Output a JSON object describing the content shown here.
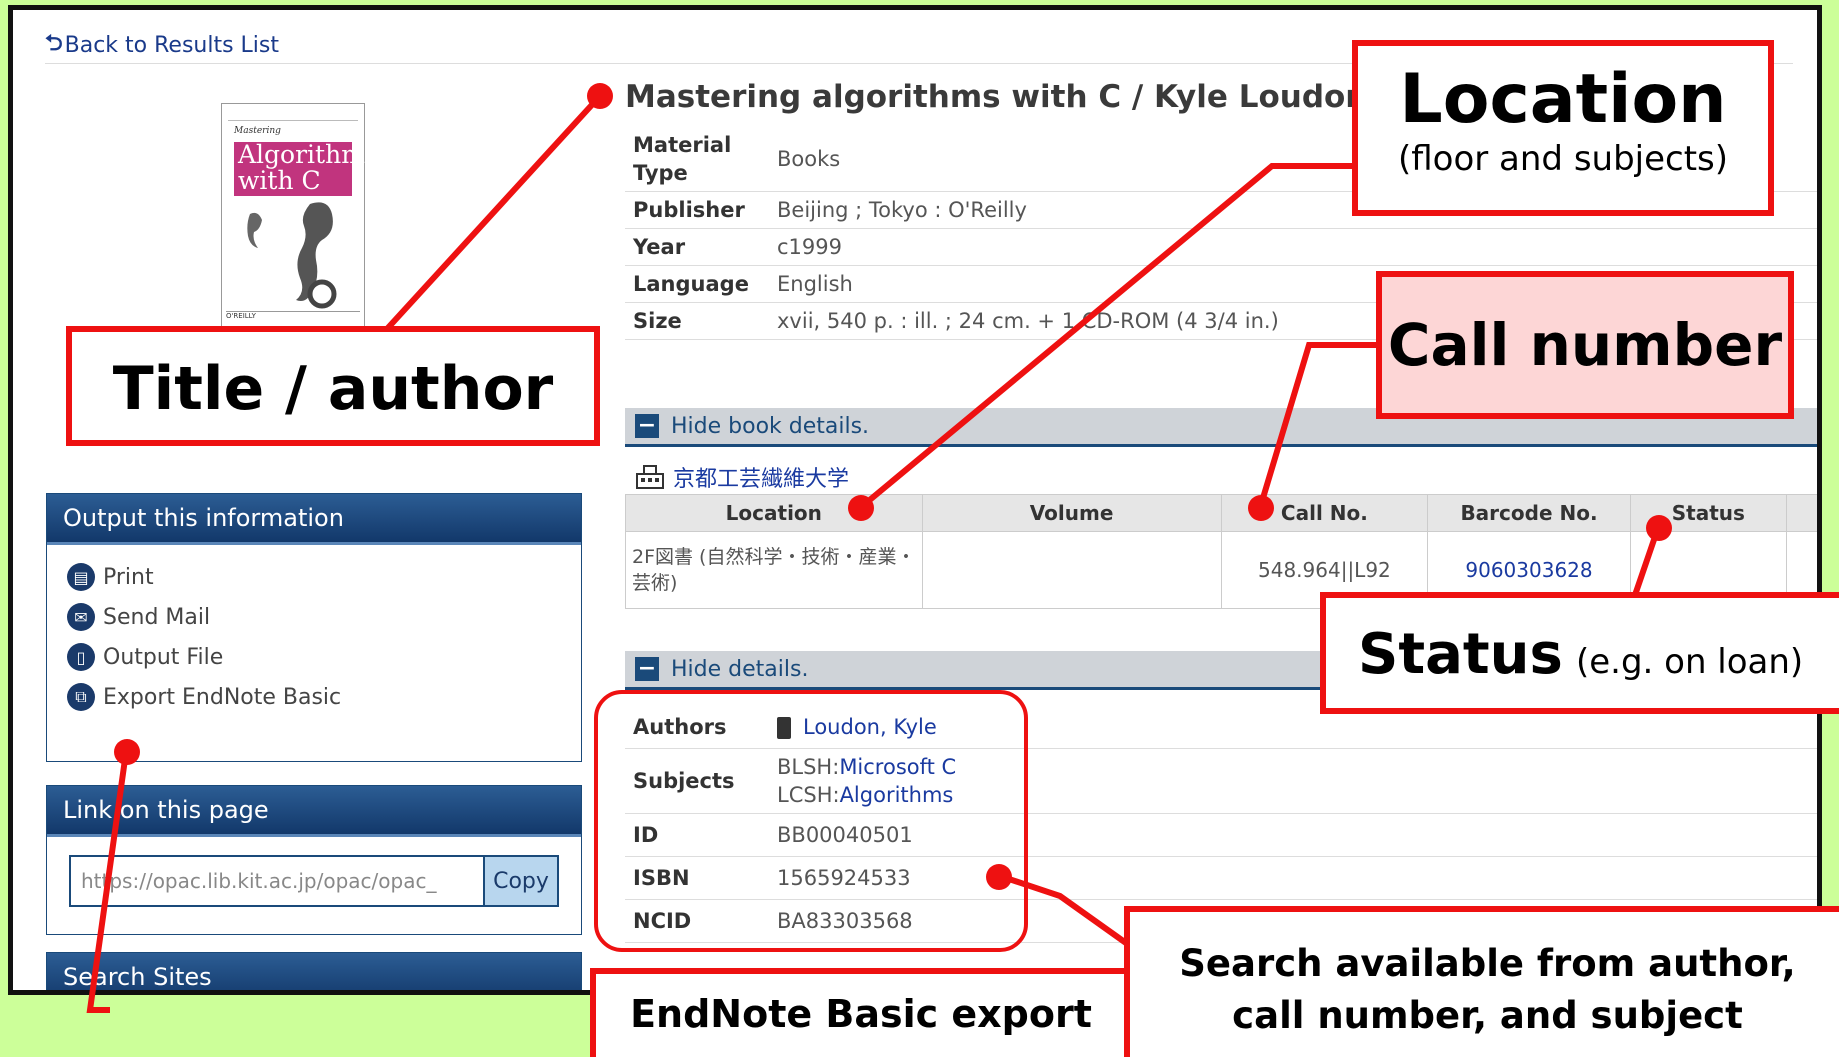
{
  "nav": {
    "back_label": "Back to Results List"
  },
  "record": {
    "title": "Mastering algorithms with C / Kyle Loudon",
    "meta": [
      {
        "label": "Material Type",
        "value": "Books"
      },
      {
        "label": "Publisher",
        "value": "Beijing ; Tokyo : O'Reilly"
      },
      {
        "label": "Year",
        "value": "c1999"
      },
      {
        "label": "Language",
        "value": "English"
      },
      {
        "label": "Size",
        "value": "xvii, 540 p. : ill. ; 24 cm. + 1 CD-ROM (4 3/4 in.)"
      }
    ]
  },
  "cover": {
    "series": "Mastering",
    "title_line1": "Algorithms",
    "title_line2": "with C",
    "publisher": "O'REILLY"
  },
  "book_details_toggle": "Hide book details.",
  "holdings": {
    "library_name": "京都工芸繊維大学",
    "columns": [
      "Location",
      "Volume",
      "Call No.",
      "Barcode No.",
      "Status"
    ],
    "rows": [
      {
        "location": "2F図書 (自然科学・技術・産業・芸術)",
        "volume": "",
        "call_no": "548.964||L92",
        "barcode": "9060303628",
        "status": ""
      }
    ]
  },
  "details_toggle": "Hide details.",
  "details": {
    "authors_label": "Authors",
    "author_name": "Loudon, Kyle",
    "subjects_label": "Subjects",
    "subject1_prefix": "BLSH:",
    "subject1": "Microsoft C",
    "subject2_prefix": "LCSH:",
    "subject2": "Algorithms",
    "id_label": "ID",
    "id_value": "BB00040501",
    "isbn_label": "ISBN",
    "isbn_value": "1565924533",
    "ncid_label": "NCID",
    "ncid_value": "BA83303568"
  },
  "sidebar": {
    "output_title": "Output this information",
    "output_items": [
      "Print",
      "Send Mail",
      "Output File",
      "Export EndNote Basic"
    ],
    "link_title": "Link on this page",
    "link_url": "https://opac.lib.kit.ac.jp/opac/opac_",
    "copy_label": "Copy",
    "next_title": "Search Sites"
  },
  "callouts": {
    "location_title": "Location",
    "location_sub": "(floor and subjects)",
    "call_number": "Call number",
    "title_author": "Title / author",
    "status_title": "Status",
    "status_sub": "(e.g. on loan)",
    "search_line1": "Search available from author,",
    "search_line2": "call number, and subject",
    "endnote": "EndNote Basic export"
  },
  "colors": {
    "accent_red": "#ee1111",
    "background": "#ccff99",
    "link_blue": "#1a3aa0",
    "header_navy": "#1a4a7a"
  }
}
